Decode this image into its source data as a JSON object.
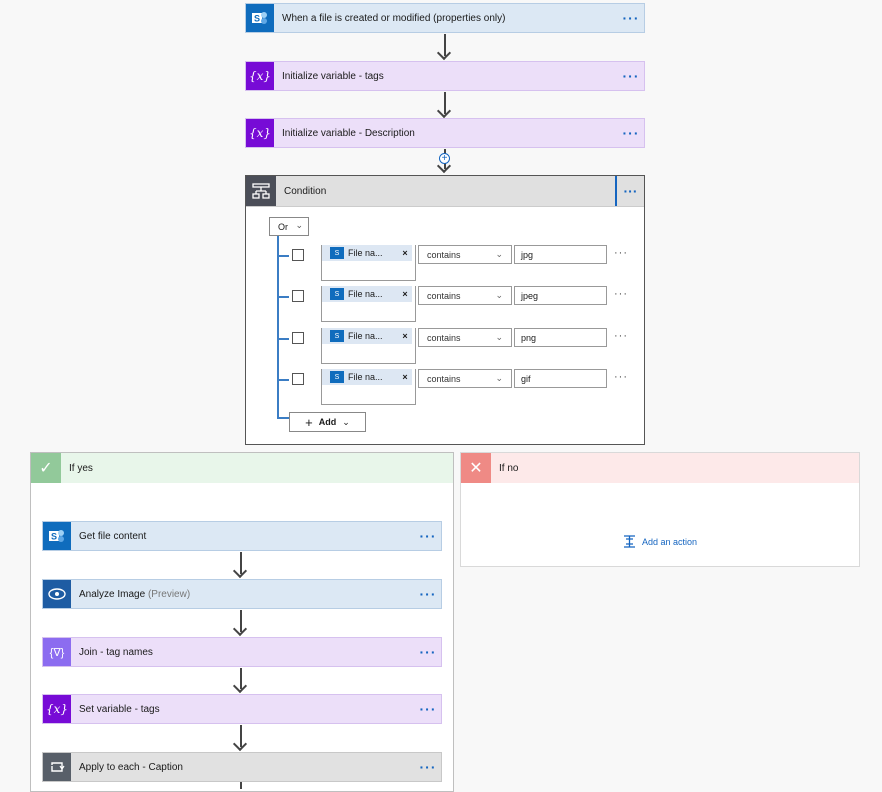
{
  "flow": {
    "trigger": {
      "title": "When a file is created or modified (properties only)",
      "icon": "sharepoint-icon"
    },
    "init_tags": {
      "title": "Initialize variable - tags",
      "icon": "variable-icon"
    },
    "init_desc": {
      "title": "Initialize variable - Description",
      "icon": "variable-icon"
    },
    "more_glyph": "···"
  },
  "condition": {
    "title": "Condition",
    "group_operator": "Or",
    "rows": [
      {
        "token": "File na...",
        "operator": "contains",
        "value": "jpg"
      },
      {
        "token": "File na...",
        "operator": "contains",
        "value": "jpeg"
      },
      {
        "token": "File na...",
        "operator": "contains",
        "value": "png"
      },
      {
        "token": "File na...",
        "operator": "contains",
        "value": "gif"
      }
    ],
    "add_label": "Add"
  },
  "if_yes": {
    "label": "If yes",
    "actions": [
      {
        "title": "Get file content",
        "subtitle": "",
        "icon": "sharepoint-icon"
      },
      {
        "title": "Analyze Image",
        "subtitle": "(Preview)",
        "icon": "eye-icon"
      },
      {
        "title": "Join - tag names",
        "subtitle": "",
        "icon": "join-icon"
      },
      {
        "title": "Set variable - tags",
        "subtitle": "",
        "icon": "variable-icon"
      },
      {
        "title": "Apply to each - Caption",
        "subtitle": "",
        "icon": "loop-icon"
      }
    ]
  },
  "if_no": {
    "label": "If no",
    "add_action_label": "Add an action"
  }
}
